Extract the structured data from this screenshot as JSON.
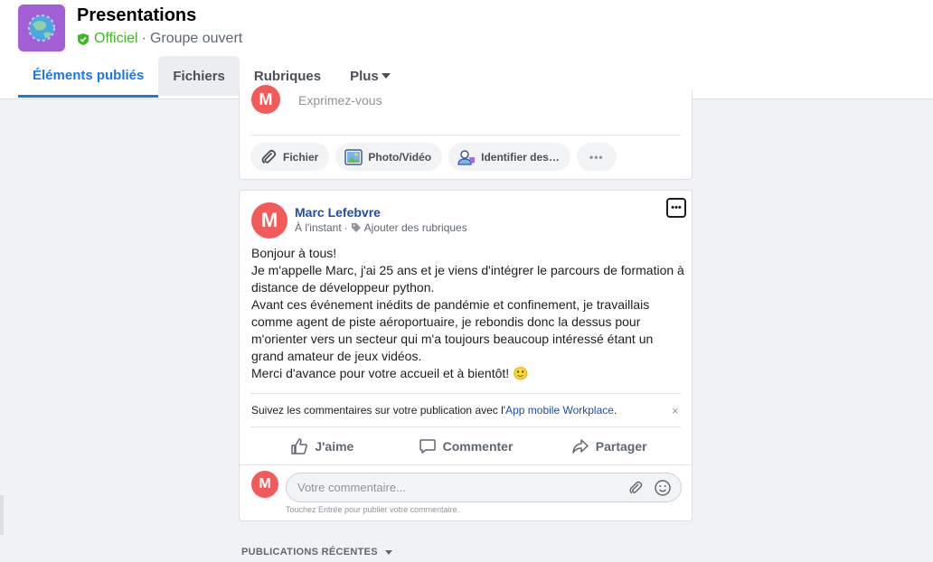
{
  "group": {
    "name": "Presentations",
    "official_label": "Officiel",
    "separator": "·",
    "privacy": "Groupe ouvert"
  },
  "tabs": [
    {
      "label": "Éléments publiés",
      "active": true
    },
    {
      "label": "Fichiers",
      "active": false
    },
    {
      "label": "Rubriques",
      "active": false
    },
    {
      "label": "Plus",
      "active": false
    }
  ],
  "composer": {
    "avatar_letter": "M",
    "prompt": "Exprimez-vous",
    "actions": [
      {
        "label": "Fichier",
        "icon": "paperclip-icon"
      },
      {
        "label": "Photo/Vidéo",
        "icon": "photo-icon"
      },
      {
        "label": "Identifier des…",
        "icon": "tag-people-icon"
      }
    ],
    "more_label": "•••"
  },
  "post": {
    "avatar_letter": "M",
    "author": "Marc Lefebvre",
    "time": "À l'instant",
    "meta_separator": "·",
    "add_topics": "Ajouter des rubriques",
    "menu_label": "•••",
    "body": "Bonjour à tous!\nJe m'appelle Marc, j'ai 25 ans et je viens d'intégrer le parcours de formation à distance de développeur python.\nAvant ces événement inédits de pandémie et confinement, je travaillais comme agent de piste aéroportuaire, je rebondis donc la dessus pour m'orienter vers un secteur qui m'a toujours beaucoup intéressé étant un grand amateur de jeux vidéos.\nMerci d'avance pour votre accueil et à bientôt!",
    "emoji": "🙂",
    "notice_text": "Suivez les commentaires sur votre publication avec l'",
    "notice_link": "App mobile Workplace",
    "notice_end": ".",
    "notice_close": "×",
    "reactions": [
      {
        "label": "J'aime",
        "icon": "thumbs-up-icon"
      },
      {
        "label": "Commenter",
        "icon": "comment-icon"
      },
      {
        "label": "Partager",
        "icon": "share-icon"
      }
    ],
    "comment": {
      "avatar_letter": "M",
      "placeholder": "Votre commentaire...",
      "value": "",
      "hint": "Touchez Entrée pour publier votre commentaire."
    }
  },
  "recent": {
    "label": "PUBLICATIONS RÉCENTES"
  },
  "colors": {
    "accent": "#1877f2",
    "official": "#42b72a",
    "avatar": "#f35b5b",
    "group_avatar": "#a35fd6",
    "link": "#1f4ea3"
  }
}
